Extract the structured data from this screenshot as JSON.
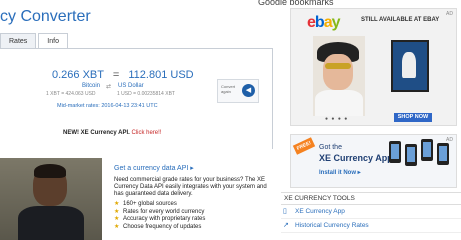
{
  "top_strip": "Google bookmarks",
  "converter": {
    "title": "cy Converter",
    "tabs": [
      "Rates",
      "Info"
    ],
    "from_amount": "0.266",
    "from_code": "XBT",
    "equals": "=",
    "to_amount": "112.801",
    "to_code": "USD",
    "from_name": "Bitcoin",
    "swap_arrows": "⇄",
    "to_name": "US Dollar",
    "rate_from": "1 XBT = 424.063 USD",
    "rate_to": "1 USD = 0.00235814 XBT",
    "convert_again_label": "Convert again",
    "midmarket": "Mid-market rates: 2016-04-13 23:41 UTC",
    "api_promo_bold": "NEW! XE Currency API.",
    "api_promo_link": "Click here!!"
  },
  "data_api": {
    "heading": "Get a currency data API ▸",
    "desc": "Need commercial grade rates for your business? The XE Currency Data API easily integrates with your system and has guaranteed data delivery.",
    "features": [
      "160+ global sources",
      "Rates for every world currency",
      "Accuracy with proprietary rates",
      "Choose frequency of updates"
    ]
  },
  "ad_ebay": {
    "ad_label": "AD",
    "brand": [
      "e",
      "b",
      "a",
      "y"
    ],
    "tagline": "STILL AVAILABLE AT EBAY",
    "cta": "SHOP NOW",
    "dots": "● ● ● ●"
  },
  "ad_xe": {
    "ad_label": "AD",
    "badge": "FREE!",
    "line1": "Got the",
    "line2": "XE Currency App?",
    "cta": "Install it Now ▸"
  },
  "tools": {
    "heading": "XE CURRENCY TOOLS",
    "items": [
      {
        "label": "XE Currency App",
        "icon": "phone-icon"
      },
      {
        "label": "Historical Currency Rates",
        "icon": "chart-icon"
      }
    ]
  },
  "colors": {
    "accent": "#2a6ebb",
    "cta": "#1f5fa8",
    "promo": "#c62828"
  }
}
